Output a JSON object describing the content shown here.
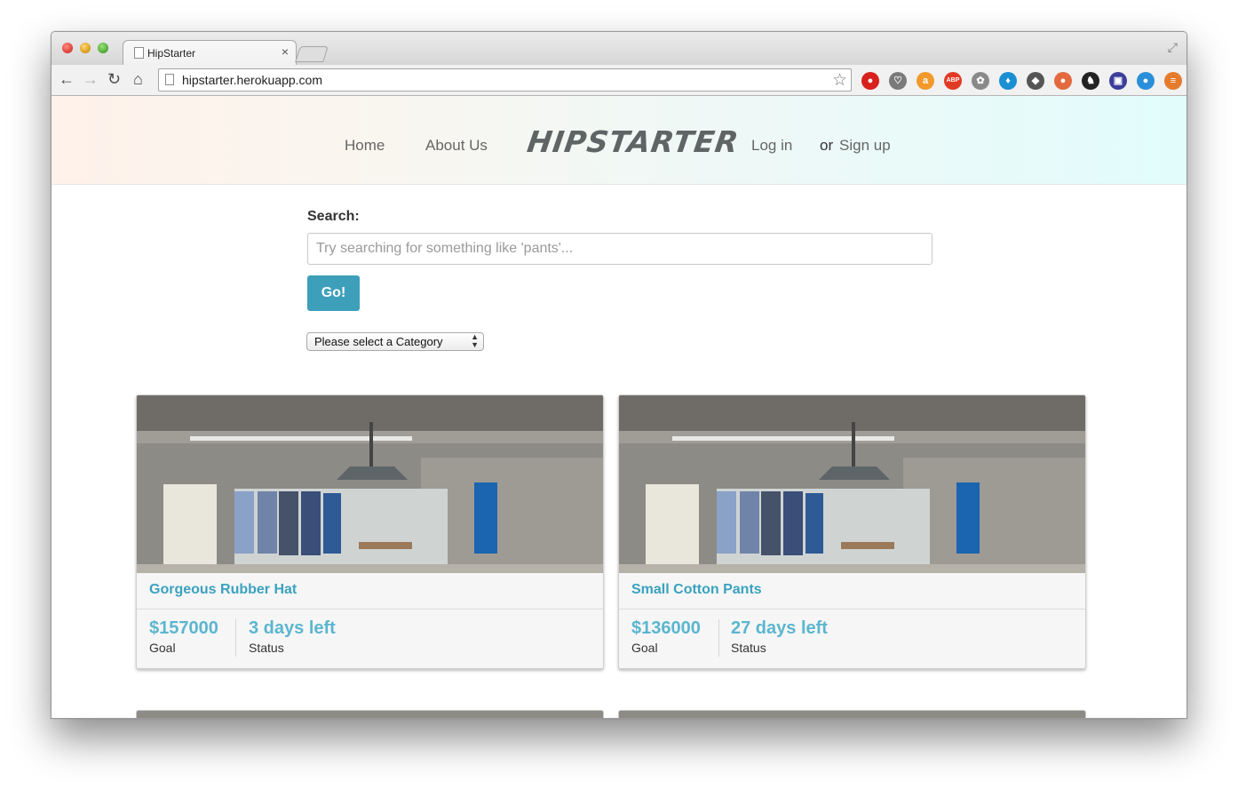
{
  "browser": {
    "tab_title": "HipStarter",
    "tab_close": "×",
    "url": "hipstarter.herokuapp.com",
    "icons": {
      "back": "←",
      "forward": "→",
      "reload": "↻",
      "home": "⌂",
      "star": "☆",
      "fullscreen": "⤢"
    },
    "extensions": [
      {
        "name": "adblock-stop-icon",
        "color": "#d8211d",
        "glyph": "●"
      },
      {
        "name": "pocket-icon",
        "color": "#7a7a7a",
        "glyph": "♡"
      },
      {
        "name": "amazon-icon",
        "color": "#f19a2b",
        "glyph": "a"
      },
      {
        "name": "abp-icon",
        "color": "#e23b25",
        "glyph": "ABP"
      },
      {
        "name": "brain-icon",
        "color": "#8a8a8a",
        "glyph": "✿"
      },
      {
        "name": "diamond-icon",
        "color": "#1a8fd3",
        "glyph": "♦"
      },
      {
        "name": "evernote-icon",
        "color": "#555555",
        "glyph": "◆"
      },
      {
        "name": "bird-icon",
        "color": "#e36a3f",
        "glyph": "●"
      },
      {
        "name": "cowboy-icon",
        "color": "#222222",
        "glyph": "♞"
      },
      {
        "name": "image-icon",
        "color": "#3c3f9a",
        "glyph": "▣"
      },
      {
        "name": "chat-icon",
        "color": "#2a8fd9",
        "glyph": "●"
      },
      {
        "name": "menu-icon",
        "color": "#e57b2d",
        "glyph": "≡"
      }
    ]
  },
  "header": {
    "nav_home": "Home",
    "nav_about": "About Us",
    "logo": "HIPSTARTER",
    "nav_login": "Log in",
    "nav_or": "or",
    "nav_signup": "Sign up"
  },
  "search": {
    "label": "Search:",
    "placeholder": "Try searching for something like 'pants'...",
    "value": "",
    "button": "Go!",
    "category_selected": "Please select a Category"
  },
  "projects": [
    {
      "title": "Gorgeous Rubber Hat",
      "goal": "$157000",
      "goal_label": "Goal",
      "status": "3 days left",
      "status_label": "Status"
    },
    {
      "title": "Small Cotton Pants",
      "goal": "$136000",
      "goal_label": "Goal",
      "status": "27 days left",
      "status_label": "Status"
    }
  ],
  "colors": {
    "accent": "#3e9fba",
    "title_blue": "#3aa2bf",
    "stat_blue": "#5bb6cf"
  }
}
